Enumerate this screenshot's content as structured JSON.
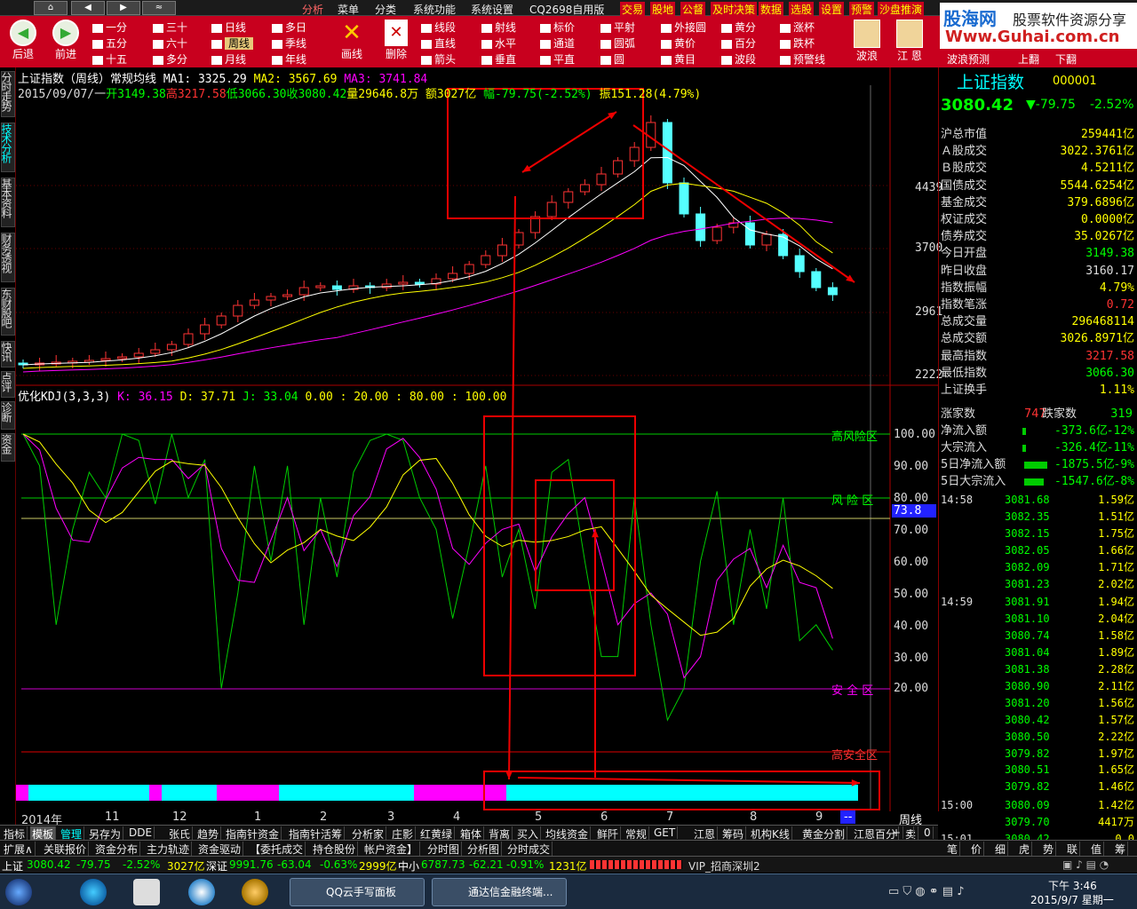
{
  "topmenu": {
    "nav": [
      "⌂",
      "◀",
      "▶",
      "≈"
    ],
    "center": [
      "分析",
      "菜单",
      "分类",
      "系统功能",
      "系统设置",
      "CQ2698自用版"
    ],
    "right": [
      "交易",
      "股地",
      "公督",
      "及时决策",
      "数据",
      "选股",
      "设置",
      "预警",
      "沙盘推演"
    ]
  },
  "toolbar": {
    "back": "后退",
    "forward": "前进",
    "periods": [
      "一分",
      "五分",
      "十五",
      "三十",
      "六十",
      "多分",
      "日线",
      "周线",
      "月线",
      "多日",
      "季线",
      "年线"
    ],
    "draw": [
      "画线",
      "删除"
    ],
    "tools": [
      "线段",
      "直线",
      "箭头",
      "射线",
      "水平",
      "垂直",
      "标价",
      "通道",
      "平直",
      "平射",
      "圆弧",
      "圆",
      "外接圆",
      "黄价",
      "黄目",
      "黄分",
      "百分",
      "波段",
      "涨杯",
      "跌杯",
      "预警线"
    ],
    "right": [
      "波浪",
      "江 恩",
      "波浪预测",
      "上翻",
      "下翻"
    ]
  },
  "brand": {
    "line1": "股海网",
    "line2": "股票软件资源分享",
    "line3": "Www.Guhai.com.cn"
  },
  "leftnav": [
    "分时走势",
    "技术分析",
    "基本资料",
    "财务透视",
    "东财股吧",
    "快讯",
    "点评",
    "诊断",
    "资金"
  ],
  "chart": {
    "title": "上证指数（周线）常规均线",
    "ma1": "MA1: 3325.29",
    "ma2": "MA2: 3567.69",
    "ma3": "MA3: 3741.84",
    "line2": {
      "date": "2015/09/07/一",
      "open": "开3149.38",
      "high": "高3217.58",
      "low": "低3066.30",
      "close": "收3080.42",
      "vol": "量29646.8万",
      "amt": "额3027亿",
      "chg": "幅-79.75(-2.52%)",
      "amp": "振151.28(4.79%)"
    },
    "price_ticks": [
      "4439",
      "3700",
      "2961",
      "2222"
    ],
    "kdj_title": "优化KDJ(3,3,3)",
    "k": "K: 36.15",
    "d": "D: 37.71",
    "j": "J: 33.04",
    "levels": "0.00 : 20.00 : 80.00 : 100.00",
    "kdj_ticks": [
      "100.00",
      "90.00",
      "80.00",
      "70.00",
      "60.00",
      "50.00",
      "40.00",
      "30.00",
      "20.00"
    ],
    "zones": [
      "高风险区",
      "风 险 区",
      "安 全 区",
      "高安全区"
    ],
    "cursor": "73.8",
    "xlabels": [
      "2014年",
      "11",
      "12",
      "1",
      "2",
      "3",
      "4",
      "5",
      "6",
      "7",
      "8",
      "9",
      "--"
    ],
    "period": "周线"
  },
  "quote": {
    "name": "上证指数",
    "code": "000001",
    "price": "3080.42",
    "chg": "▼-79.75",
    "pct": "-2.52%",
    "rows": [
      [
        "沪总市值",
        "259441亿",
        "#ff0"
      ],
      [
        "Ａ股成交",
        "3022.3761亿",
        "#ff0"
      ],
      [
        "Ｂ股成交",
        "4.5211亿",
        "#ff0"
      ],
      [
        "国债成交",
        "5544.6254亿",
        "#ff0"
      ],
      [
        "基金成交",
        "379.6896亿",
        "#ff0"
      ],
      [
        "权证成交",
        "0.0000亿",
        "#ff0"
      ],
      [
        "债券成交",
        "35.0267亿",
        "#ff0"
      ],
      [
        "今日开盘",
        "3149.38",
        "#0f0"
      ],
      [
        "昨日收盘",
        "3160.17",
        "#ddd"
      ],
      [
        "指数振幅",
        "4.79%",
        "#ff0"
      ],
      [
        "指数笔涨",
        "0.72",
        "#f33"
      ],
      [
        "总成交量",
        "296468114",
        "#ff0"
      ],
      [
        "总成交额",
        "3026.8971亿",
        "#ff0"
      ],
      [
        "最高指数",
        "3217.58",
        "#f33"
      ],
      [
        "最低指数",
        "3066.30",
        "#0f0"
      ],
      [
        "上证换手",
        "1.11%",
        "#ff0"
      ]
    ],
    "up_label": "涨家数",
    "up": "747",
    "down_label": "跌家数",
    "down": "319",
    "flows": [
      [
        "净流入额",
        "-373.6亿",
        "-12%"
      ],
      [
        "大宗流入",
        "-326.4亿",
        "-11%"
      ],
      [
        "5日净流入额",
        "-1875.5亿",
        "-9%"
      ],
      [
        "5日大宗流入",
        "-1547.6亿",
        "-8%"
      ]
    ],
    "ticks": [
      [
        "14:58",
        "3081.68",
        "1.59亿"
      ],
      [
        "",
        "3082.35",
        "1.51亿"
      ],
      [
        "",
        "3082.15",
        "1.75亿"
      ],
      [
        "",
        "3082.05",
        "1.66亿"
      ],
      [
        "",
        "3082.09",
        "1.71亿"
      ],
      [
        "",
        "3081.23",
        "2.02亿"
      ],
      [
        "14:59",
        "3081.91",
        "1.94亿"
      ],
      [
        "",
        "3081.10",
        "2.04亿"
      ],
      [
        "",
        "3080.74",
        "1.58亿"
      ],
      [
        "",
        "3081.04",
        "1.89亿"
      ],
      [
        "",
        "3081.38",
        "2.28亿"
      ],
      [
        "",
        "3080.90",
        "2.11亿"
      ],
      [
        "",
        "3081.20",
        "1.56亿"
      ],
      [
        "",
        "3080.42",
        "1.57亿"
      ],
      [
        "",
        "3080.50",
        "2.22亿"
      ],
      [
        "",
        "3079.82",
        "1.97亿"
      ],
      [
        "",
        "3080.51",
        "1.65亿"
      ],
      [
        "",
        "3079.82",
        "1.46亿"
      ],
      [
        "15:00",
        "3080.09",
        "1.42亿"
      ],
      [
        "",
        "3079.70",
        "4417万"
      ],
      [
        "15:01",
        "3080.42",
        "0.0"
      ]
    ]
  },
  "tabs1": [
    "指标",
    "模板",
    "管理",
    "另存为",
    "DDE",
    "张氏",
    "趋势",
    "指南针资金",
    "指南针活筹",
    "分析家",
    "庄影",
    "红黄绿",
    "箱体",
    "背离",
    "买入",
    "均线资金",
    "鲜阡",
    "常规",
    "GET",
    "江恩",
    "筹码",
    "机构K线",
    "黄金分割",
    "江恩百分",
    "卖"
  ],
  "tabs1_right": [
    "+",
    "-",
    "0"
  ],
  "tabs2": [
    "扩展∧",
    "关联报价",
    "资金分布",
    "主力轨迹",
    "资金驱动",
    "【委托成交",
    "持仓股份",
    "帐户资金】",
    "分时图",
    "分析图",
    "分时成交"
  ],
  "tabs2_right": [
    "笔",
    "价",
    "细",
    "虎",
    "势",
    "联",
    "值",
    "筹"
  ],
  "status": {
    "sh": "上证",
    "sh_v": "3080.42",
    "sh_c": "-79.75",
    "sh_p": "-2.52%",
    "sh_a": "3027亿",
    "sz": "深证",
    "sz_v": "9991.76",
    "sz_c": "-63.04",
    "sz_p": "-0.63%",
    "sz_a": "2999亿",
    "zx": "中小",
    "zx_v": "6787.73",
    "zx_c": "-62.21",
    "zx_p": "-0.91%",
    "zx_a": "1231亿",
    "vip": "VIP_招商深圳2"
  },
  "taskbar": {
    "t1": "QQ云手写面板",
    "t2": "通达信金融终端...",
    "time": "下午 3:46",
    "date": "2015/9/7 星期一"
  }
}
